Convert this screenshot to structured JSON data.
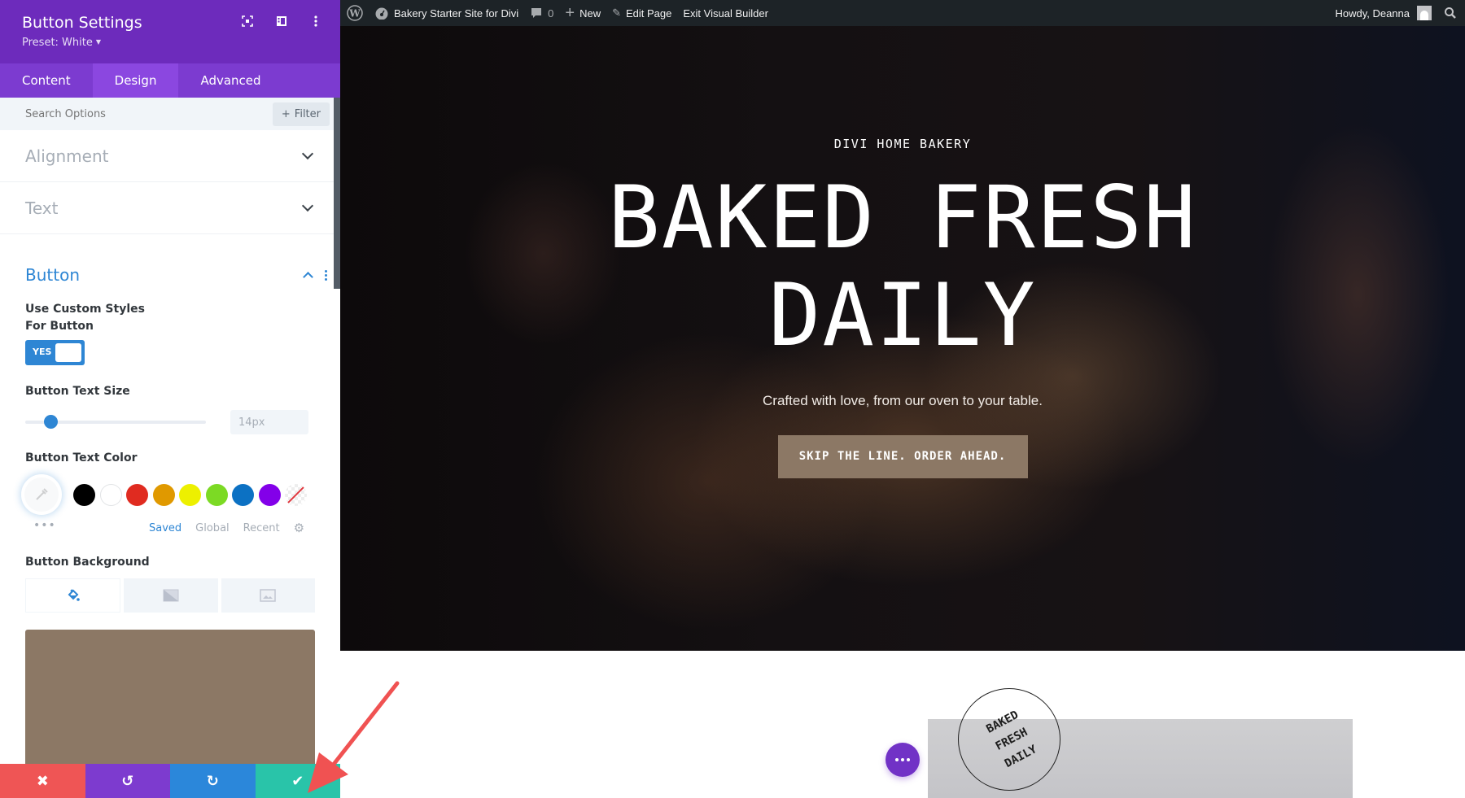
{
  "sidebar": {
    "title": "Button Settings",
    "preset": "Preset: White",
    "header_icons": [
      "focus-icon",
      "split-view-icon",
      "more-vertical-icon"
    ],
    "tabs": [
      {
        "label": "Content",
        "active": false
      },
      {
        "label": "Design",
        "active": true
      },
      {
        "label": "Advanced",
        "active": false
      }
    ],
    "search": {
      "placeholder": "Search Options",
      "value": ""
    },
    "filter_label": "Filter",
    "groups": [
      {
        "label": "Alignment",
        "expanded": false
      },
      {
        "label": "Text",
        "expanded": false
      },
      {
        "label": "Button",
        "expanded": true
      }
    ],
    "button_group": {
      "custom_styles_label": "Use Custom Styles For Button",
      "custom_styles_toggle": "YES",
      "text_size_label": "Button Text Size",
      "text_size_value": "14px",
      "text_size_slider_fraction": 0.14,
      "text_color_label": "Button Text Color",
      "swatches": [
        {
          "name": "black",
          "color": "#000000"
        },
        {
          "name": "white",
          "color": "#ffffff"
        },
        {
          "name": "red",
          "color": "#e02b20"
        },
        {
          "name": "orange",
          "color": "#e09900"
        },
        {
          "name": "yellow",
          "color": "#edf000"
        },
        {
          "name": "green",
          "color": "#7cda24"
        },
        {
          "name": "blue",
          "color": "#0c71c3"
        },
        {
          "name": "purple",
          "color": "#8300e9"
        },
        {
          "name": "none",
          "color": "transparent"
        }
      ],
      "more_label": "•••",
      "palette_tabs": [
        {
          "label": "Saved",
          "active": true
        },
        {
          "label": "Global",
          "active": false
        },
        {
          "label": "Recent",
          "active": false
        }
      ],
      "background_label": "Button Background",
      "background_tabs": [
        "color-fill-icon",
        "gradient-icon",
        "image-icon"
      ],
      "background_color": "#8c7865"
    },
    "actions": [
      {
        "name": "discard",
        "icon": "✖",
        "color": "#ef5555"
      },
      {
        "name": "undo",
        "icon": "↺",
        "color": "#7d3bcf"
      },
      {
        "name": "redo",
        "icon": "↻",
        "color": "#2b87da"
      },
      {
        "name": "save",
        "icon": "✔",
        "color": "#29c4a9"
      }
    ]
  },
  "adminbar": {
    "site_name": "Bakery Starter Site for Divi",
    "comments_count": "0",
    "new_label": "New",
    "edit_page_label": "Edit Page",
    "exit_builder_label": "Exit Visual Builder",
    "greeting": "Howdy, Deanna"
  },
  "hero": {
    "subtitle": "DIVI HOME BAKERY",
    "title_line1": "BAKED FRESH",
    "title_line2": "DAILY",
    "tagline": "Crafted with love, from our oven to your table.",
    "cta_label": "SKIP THE LINE. ORDER AHEAD.",
    "cta_color": "#8c7865"
  },
  "lower": {
    "stamp_lines": [
      "BAKED",
      "FRESH",
      "DAILY"
    ]
  },
  "colors": {
    "header_purple": "#6d2bbc",
    "tabs_purple": "#7c3bd0",
    "accent_blue": "#2e86d4",
    "annotation_arrow": "#f05252"
  }
}
